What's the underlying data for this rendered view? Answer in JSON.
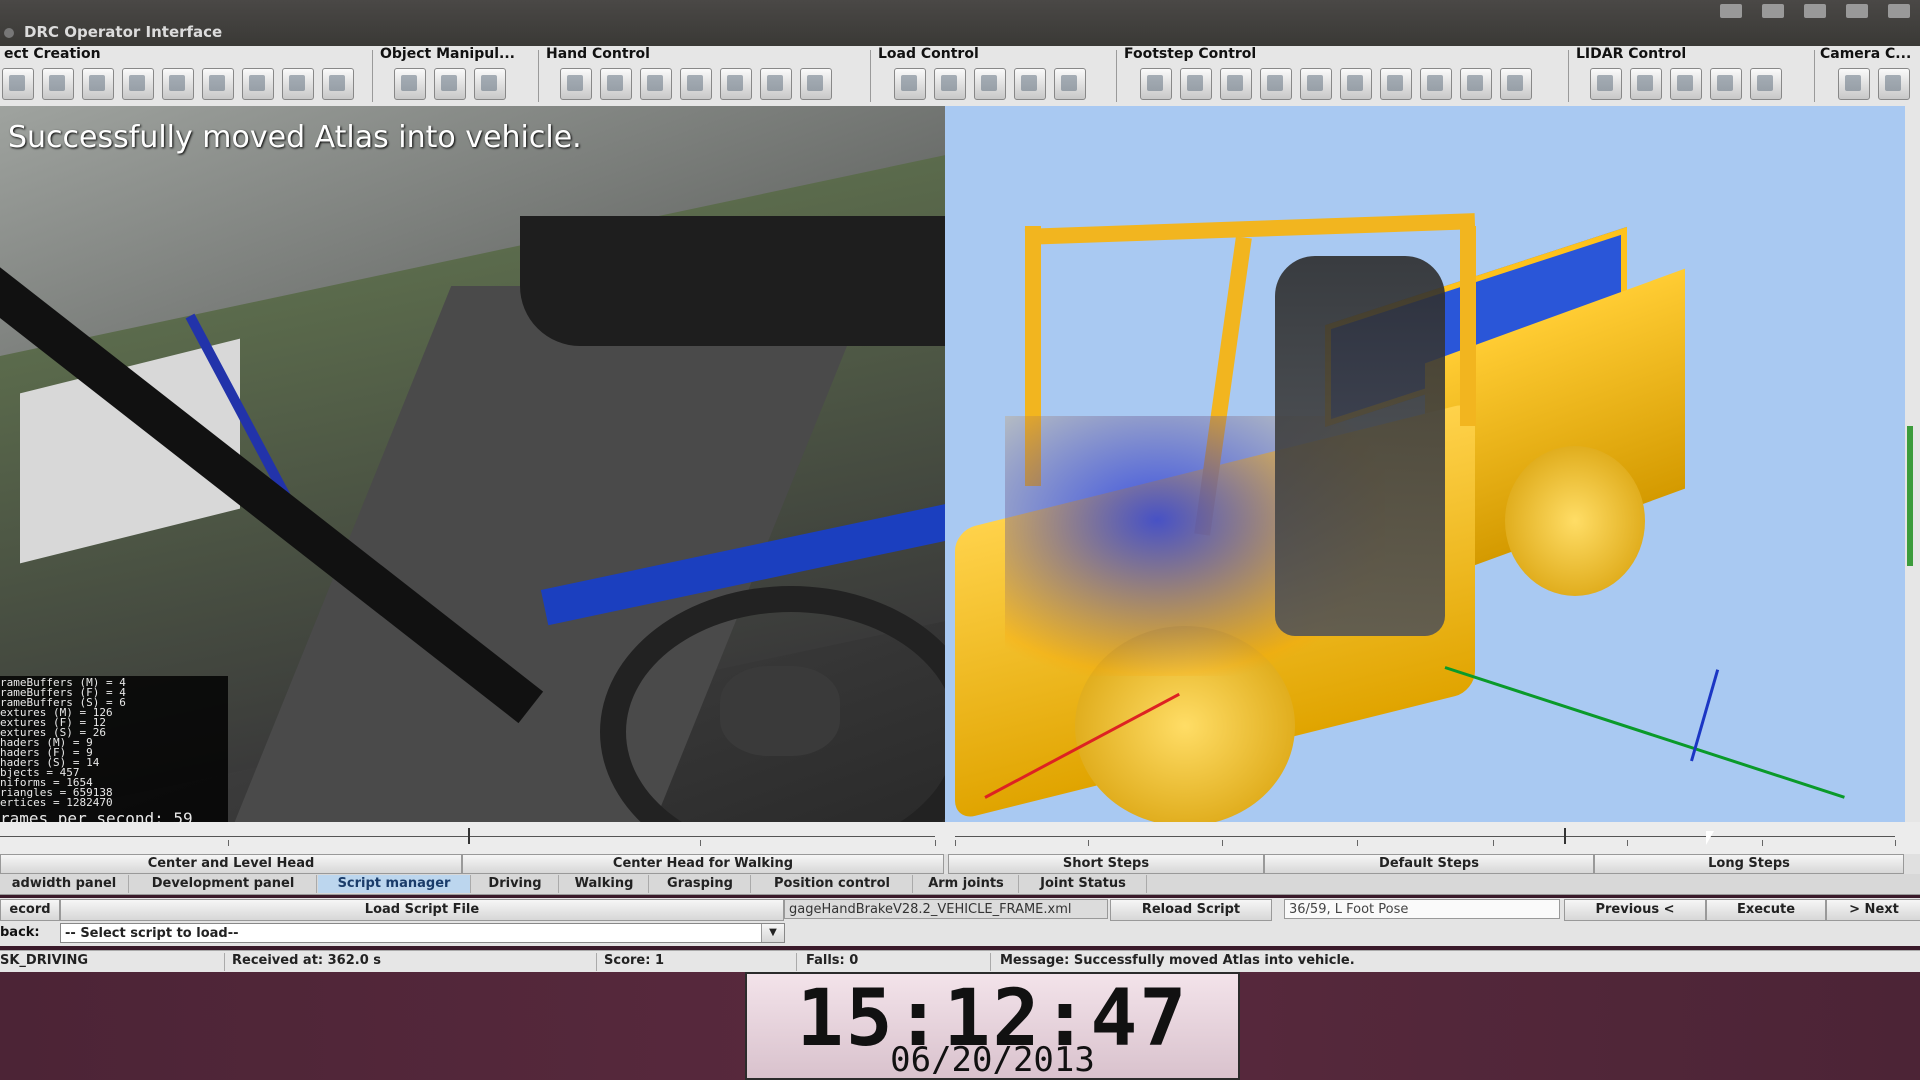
{
  "window": {
    "title": "DRC Operator Interface"
  },
  "toolbar": {
    "groups": [
      {
        "label": "ect Creation",
        "icons": [
          "object-icon",
          "cube-icon",
          "grid-icon",
          "vehicle-icon",
          "update-icon",
          "ring-icon",
          "box-icon",
          "tool-icon",
          "crosshair-icon"
        ]
      },
      {
        "label": "Object Manipul...",
        "icons": [
          "select-icon",
          "rotate-icon",
          "align-icon"
        ]
      },
      {
        "label": "Hand Control",
        "icons": [
          "place-icon",
          "close-icon",
          "blank-icon",
          "home-icon",
          "blank-icon",
          "close-icon",
          "place-icon"
        ]
      },
      {
        "label": "Load Control",
        "icons": [
          "load-icon",
          "load-icon",
          "load-icon",
          "load-icon",
          "load-icon"
        ]
      },
      {
        "label": "Footstep Control",
        "icons": [
          "foot-icon",
          "foot-icon",
          "foot-icon",
          "foot-icon",
          "scatter-icon",
          "foot-icon",
          "cross-icon",
          "snap-icon",
          "arc-icon",
          "blind-icon"
        ]
      },
      {
        "label": "LIDAR Control",
        "icons": [
          "enable-icon",
          "clear-icon",
          "display-icon",
          "display-icon",
          "black-icon"
        ]
      },
      {
        "label": "Camera C...",
        "icons": [
          "eye-icon",
          "camera-icon"
        ]
      }
    ]
  },
  "left_view": {
    "message": "Successfully moved Atlas into vehicle.",
    "stats": [
      "rameBuffers (M) = 4",
      "rameBuffers (F) = 4",
      "rameBuffers (S) = 6",
      "extures (M) = 126",
      "extures (F) = 12",
      "extures (S) = 26",
      "haders (M) = 9",
      "haders (F) = 9",
      "haders (S) = 14",
      "bjects = 457",
      "niforms = 1654",
      "riangles = 659138",
      "ertices = 1282470"
    ],
    "fps": "rames per second: 59"
  },
  "buttons_row": {
    "center_level_head": "Center and Level Head",
    "center_head_walking": "Center Head for Walking",
    "short_steps": "Short Steps",
    "default_steps": "Default Steps",
    "long_steps": "Long Steps"
  },
  "tabs": [
    {
      "label": "adwidth panel",
      "active": false
    },
    {
      "label": "Development panel",
      "active": false
    },
    {
      "label": "Script manager",
      "active": true
    },
    {
      "label": "Driving",
      "active": false
    },
    {
      "label": "Walking",
      "active": false
    },
    {
      "label": "Grasping",
      "active": false
    },
    {
      "label": "Position control",
      "active": false
    },
    {
      "label": "Arm joints",
      "active": false
    },
    {
      "label": "Joint Status",
      "active": false
    }
  ],
  "script": {
    "record_label": "ecord",
    "load_script_label": "Load Script File",
    "file_name": "gageHandBrakeV28.2_VEHICLE_FRAME.xml",
    "reload_label": "Reload Script",
    "pose_field": "36/59, L Foot Pose",
    "previous_label": "Previous <",
    "execute_label": "Execute",
    "next_label": "> Next",
    "playback_label": "back:",
    "select_placeholder": "-- Select script to load--"
  },
  "status": {
    "task": "SK_DRIVING",
    "received": "Received at:  362.0 s",
    "score": "Score:  1",
    "falls": "Falls:  0",
    "message": "Message:  Successfully moved Atlas into vehicle."
  },
  "clock": {
    "time": "15:12:47",
    "date": "06/20/2013"
  }
}
